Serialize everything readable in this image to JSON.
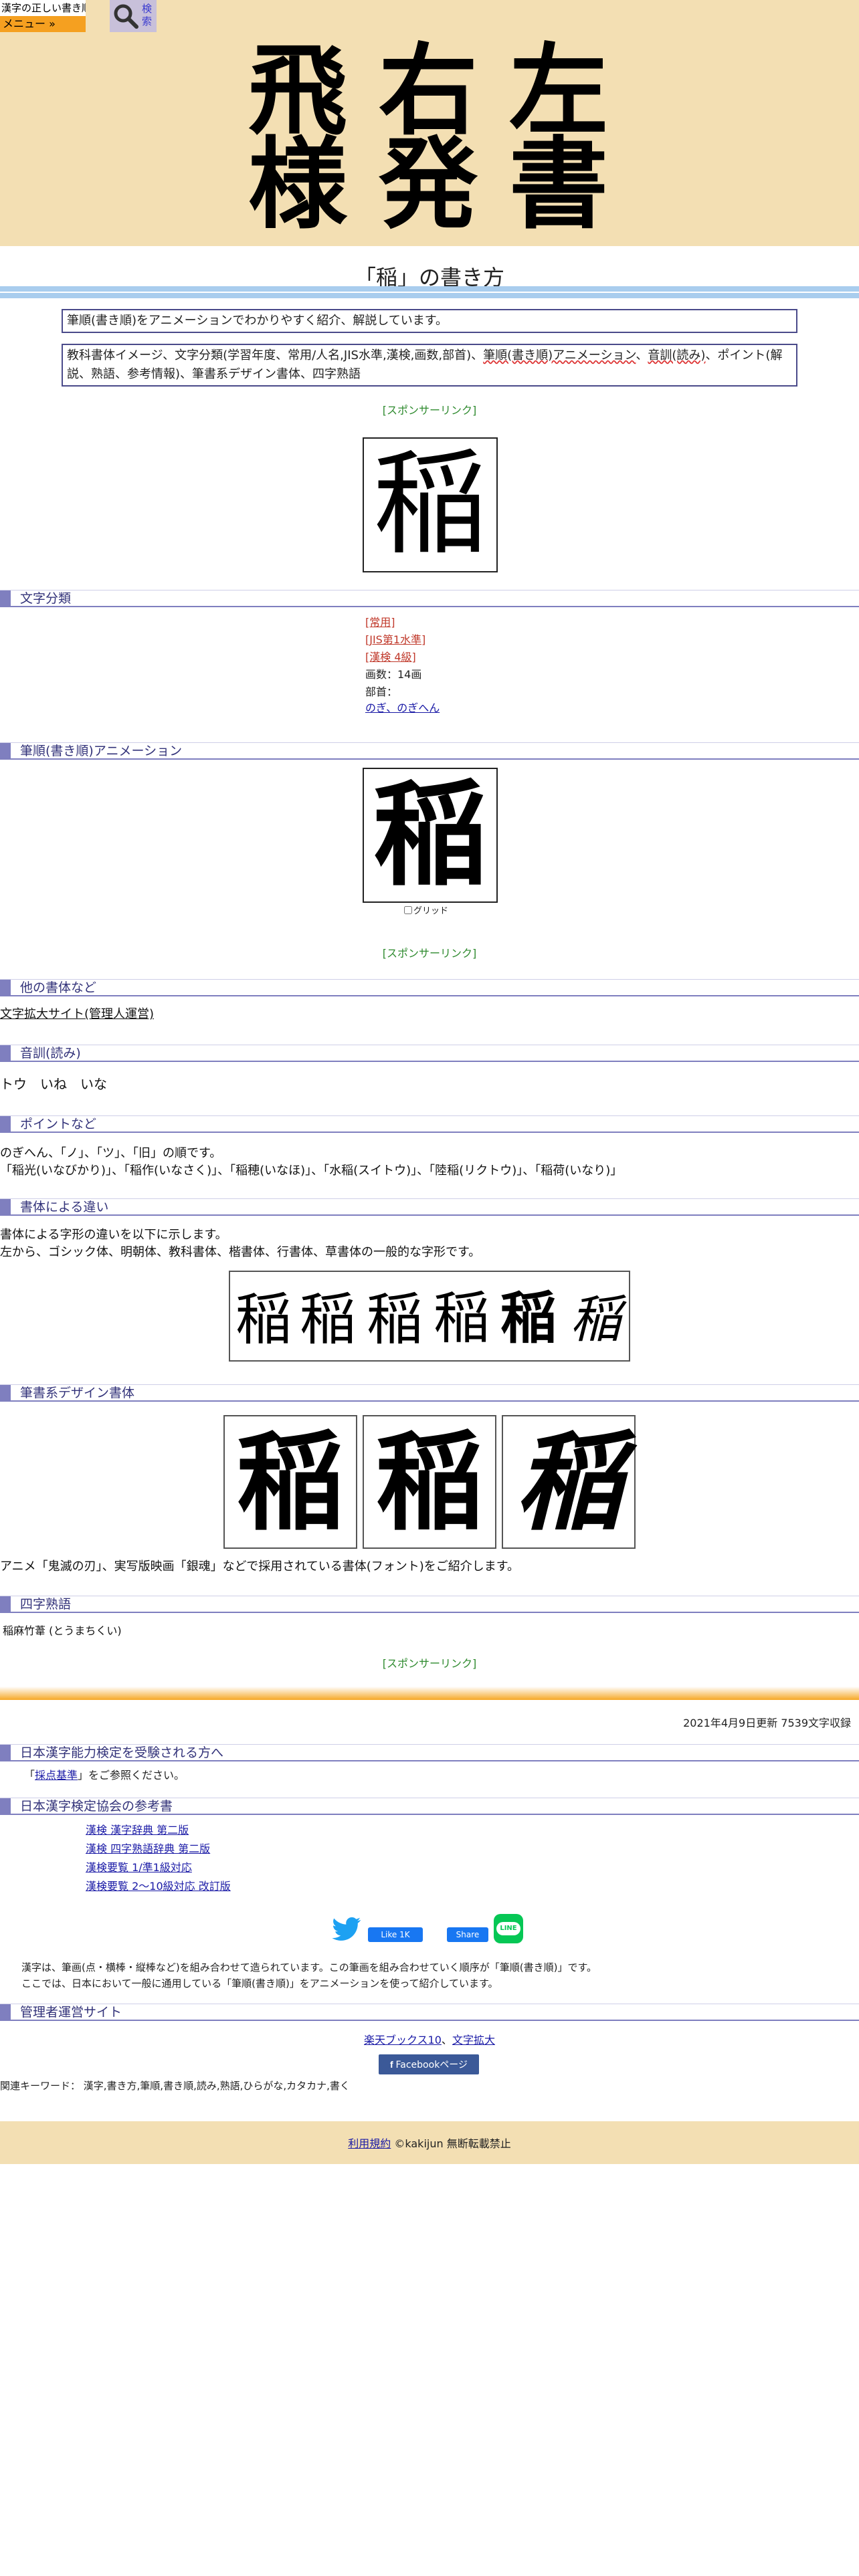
{
  "header": {
    "logo_text": "漢字の正しい書き順(筆順)",
    "menu_label": "メニュー »",
    "search_label": "検索",
    "hero_chars": [
      "飛",
      "右",
      "左",
      "様",
      "発",
      "書"
    ]
  },
  "page": {
    "title": "「稲」の書き方",
    "intro1": "筆順(書き順)をアニメーションでわかりやすく紹介、解説しています。",
    "intro2": {
      "part1": "教科書体イメージ、文字分類(学習年度、常用/人名,JIS水準,漢検,画数,部首)、",
      "part2": "筆順(書き順)アニメーション",
      "part3": "、",
      "part4": "音訓(読み)",
      "part5": "、ポイント(解説、熟語、参考情報)、筆書系デザイン書体、四字熟語"
    },
    "sponsor": "[スポンサーリンク]",
    "main_char": "稲"
  },
  "sections": {
    "classification": "文字分類",
    "animation": "筆順(書き順)アニメーション",
    "other_fonts": "他の書体など",
    "reading": "音訓(読み)",
    "points": "ポイントなど",
    "font_diff": "書体による違い",
    "brush_design": "筆書系デザイン書体",
    "yoji": "四字熟語",
    "kanken_exam": "日本漢字能力検定を受験される方へ",
    "kanken_ref": "日本漢字検定協会の参考書",
    "admin_sites": "管理者運営サイト"
  },
  "classification": {
    "items": [
      "[常用]",
      "[JIS第1水準]",
      "[漢検 4級]"
    ],
    "strokes": "画数：14画",
    "radical_label": "部首：",
    "radical_link": "のぎ、のぎへん"
  },
  "animation": {
    "grid_label": "グリッド"
  },
  "other_fonts": {
    "link": "文字拡大サイト(管理人運営)"
  },
  "reading": {
    "text": "トウ　いね　いな"
  },
  "points": {
    "line1": "のぎへん、「ノ」、「ツ」、「旧」の順です。",
    "line2": "「稲光(いなびかり)」、「稲作(いなさく)」、「稲穂(いなほ)」、「水稲(スイトウ)」、「陸稲(リクトウ)」、「稲荷(いなり)」"
  },
  "font_diff": {
    "line1": "書体による字形の違いを以下に示します。",
    "line2": "左から、ゴシック体、明朝体、教科書体、楷書体、行書体、草書体の一般的な字形です。"
  },
  "brush_design": {
    "caption": "アニメ「鬼滅の刃」、実写版映画「銀魂」などで採用されている書体(フォント)をご紹介します。"
  },
  "yoji": {
    "text": "稲麻竹葦 (とうまちくい)"
  },
  "meta": {
    "updated": "2021年4月9日更新 7539文字収録"
  },
  "kanken_exam": {
    "open": "「",
    "link": "採点基準",
    "close": "」をご参照ください。"
  },
  "kanken_ref": {
    "books": [
      "漢検 漢字辞典 第二版",
      "漢検 四字熟語辞典 第二版",
      "漢検要覧 1/準1級対応",
      "漢検要覧 2～10級対応 改訂版"
    ]
  },
  "social": {
    "like": "Like 1K",
    "share": "Share"
  },
  "explain": {
    "line1": "漢字は、筆画(点・横棒・縦棒など)を組み合わせて造られています。この筆画を組み合わせていく順序が「筆順(書き順)」です。",
    "line2": "ここでは、日本において一般に通用している「筆順(書き順)」をアニメーションを使って紹介しています。"
  },
  "admin": {
    "link1": "楽天ブックス10",
    "sep": "、",
    "link2": "文字拡大",
    "fb_page": "Facebookページ"
  },
  "keywords": "関連キーワード： 漢字,書き方,筆順,書き順,読み,熟語,ひらがな,カタカナ,書く",
  "footer": {
    "terms": "利用規約",
    "copyright": "©kakijun 無断転載禁止"
  },
  "colors": {
    "header_bg": "#f3dfb3",
    "menu_bg": "#f5a020",
    "section_accent": "#7f7fbf",
    "title_rule": "#a9cdee",
    "sponsor_green": "#2e8a2e",
    "class_red": "#c0392b"
  }
}
